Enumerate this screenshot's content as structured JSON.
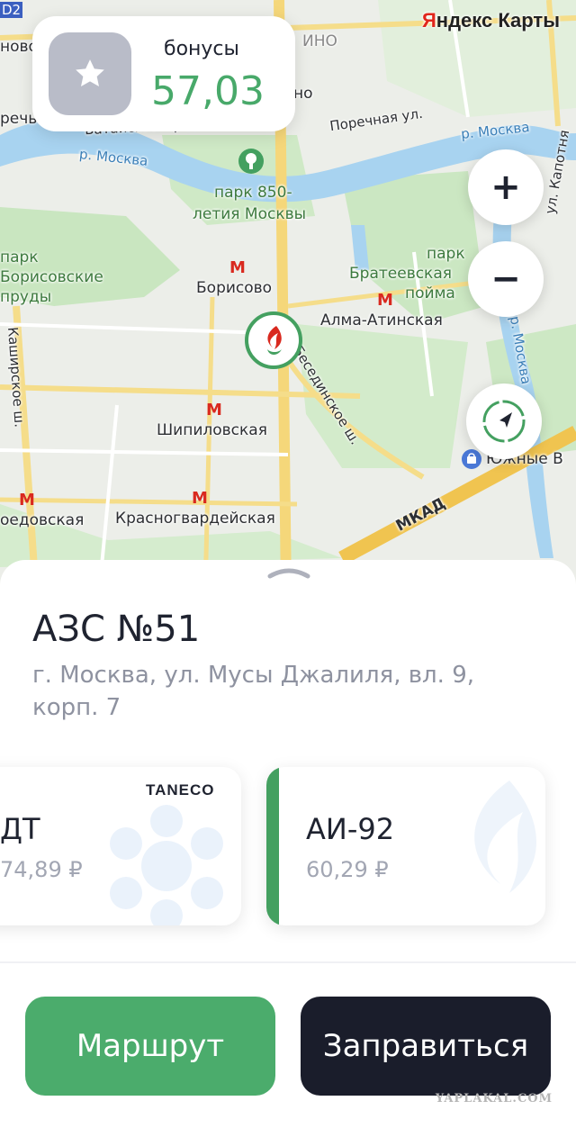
{
  "map": {
    "provider_logo": {
      "prefix": "Я",
      "rest": "ндекс Карты"
    },
    "labels": {
      "d2": "D2",
      "novo": "ново",
      "ino": "ИНО",
      "no": "но",
      "rechye": "речье",
      "batayskiy": "Батайский пр-д",
      "rechnaya": "Поречная ул.",
      "river_left": "р. Москва",
      "river_right": "р. Москва",
      "river_vertical": "р. Москва",
      "kapotnya": "ул. Капотня",
      "park850": "парк 850-",
      "park850_2": "летия Москвы",
      "park_boris1": "парк",
      "park_boris2": "Борисовские",
      "park_boris3": "пруды",
      "borisovo": "Борисово",
      "park_brat1": "парк",
      "park_brat2": "Братеевская",
      "park_brat3": "пойма",
      "alma": "Алма-Атинская",
      "kashirskoe": "Каширское ш.",
      "besedinskoe": "Бесединское ш.",
      "shipilovskaya": "Шипиловская",
      "domodedovskaya": "оедовская",
      "krasnogvard": "Красногвардейская",
      "mkad": "МКАД",
      "yuzhnye": "Южные В"
    },
    "metro_icon": "M",
    "zoom_in": "+",
    "zoom_out": "−",
    "colors": {
      "park": "#c9e6c0",
      "water": "#a8d3f0",
      "road": "#f7e08f",
      "block": "#f6f6f3"
    }
  },
  "bonus": {
    "label": "бонусы",
    "value": "57,03",
    "icon": "star-icon"
  },
  "station": {
    "title": "АЗС №51",
    "address": "г. Москва, ул. Мусы Джалиля, вл. 9, корп. 7",
    "pin_icon": "flame-logo-icon"
  },
  "fuels": [
    {
      "name": "ДТ",
      "price": "74,89 ₽",
      "brand": "TANECO"
    },
    {
      "name": "АИ-92",
      "price": "60,29 ₽",
      "selected": true
    }
  ],
  "actions": {
    "route": "Маршрут",
    "refuel": "Заправиться"
  },
  "watermark": "YAPLAKAL.COM",
  "theme": {
    "accent": "#4bac6c",
    "dark": "#1a1d2b"
  }
}
